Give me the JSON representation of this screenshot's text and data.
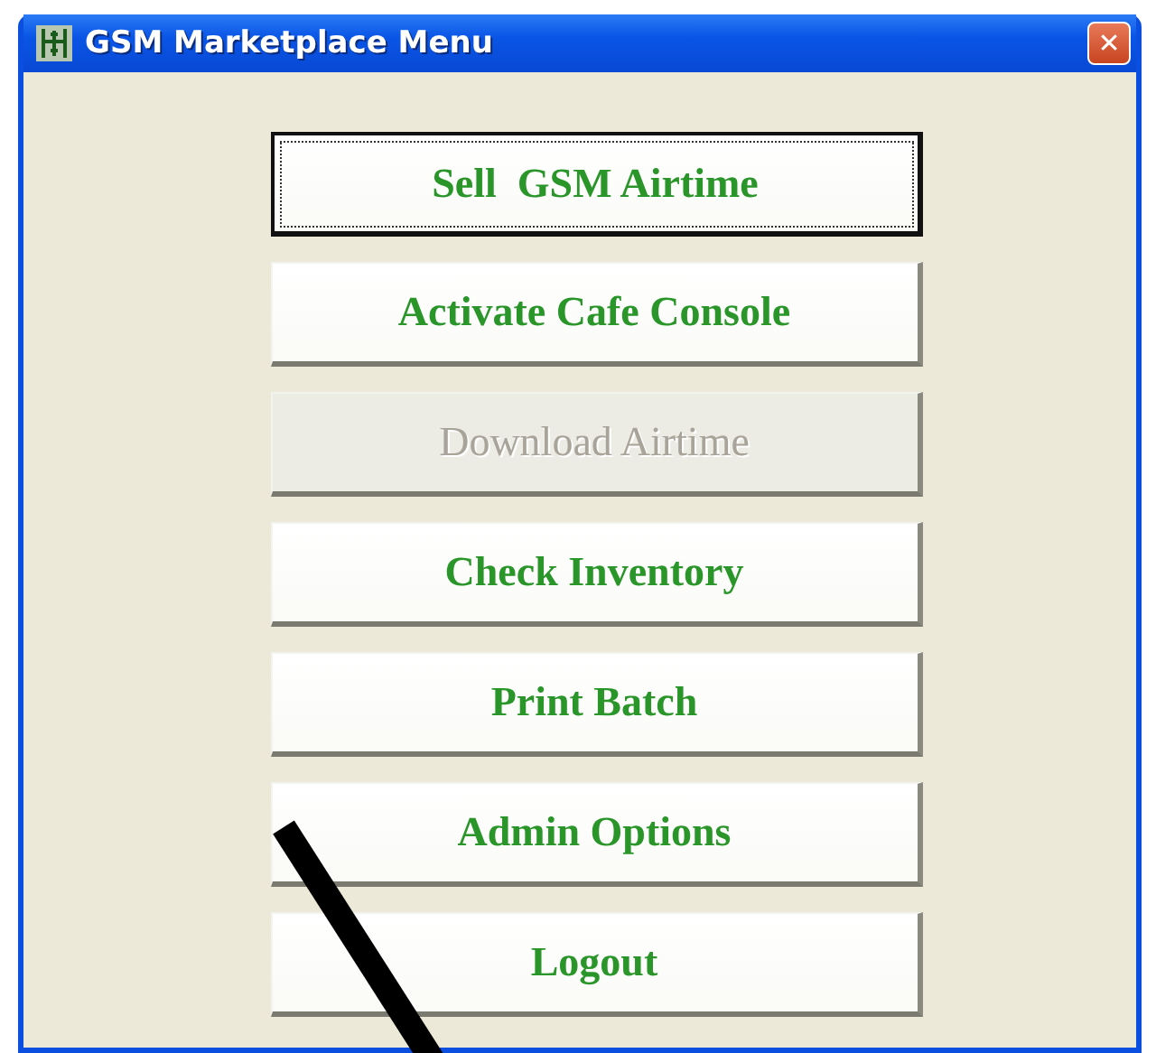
{
  "window": {
    "title": "GSM Marketplace Menu",
    "close": "✕"
  },
  "buttons": [
    {
      "label": "Sell  GSM Airtime",
      "focused": true,
      "disabled": false
    },
    {
      "label": "Activate Cafe Console",
      "focused": false,
      "disabled": false
    },
    {
      "label": "Download Airtime",
      "focused": false,
      "disabled": true
    },
    {
      "label": "Check Inventory",
      "focused": false,
      "disabled": false
    },
    {
      "label": "Print Batch",
      "focused": false,
      "disabled": false
    },
    {
      "label": "Admin Options",
      "focused": false,
      "disabled": false
    },
    {
      "label": "Logout",
      "focused": false,
      "disabled": false
    }
  ]
}
